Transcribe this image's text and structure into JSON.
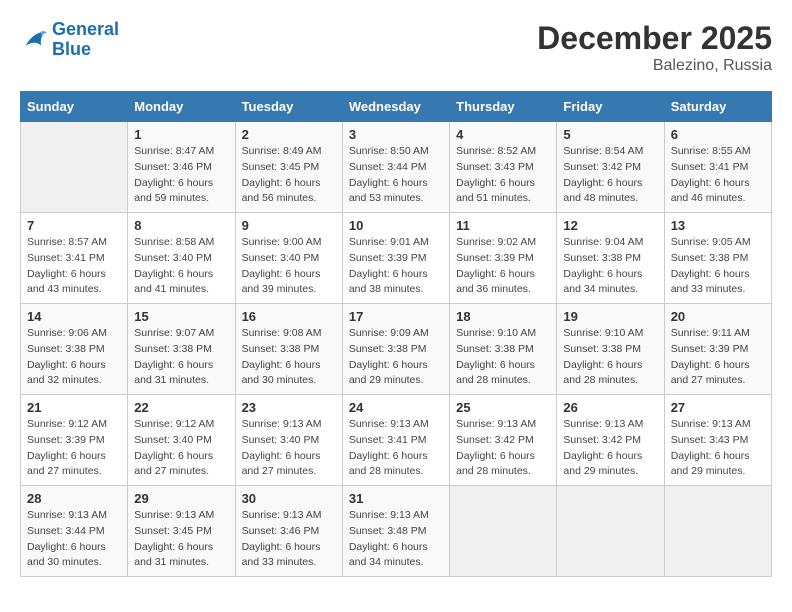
{
  "header": {
    "logo_general": "General",
    "logo_blue": "Blue",
    "month": "December 2025",
    "location": "Balezino, Russia"
  },
  "days_of_week": [
    "Sunday",
    "Monday",
    "Tuesday",
    "Wednesday",
    "Thursday",
    "Friday",
    "Saturday"
  ],
  "weeks": [
    [
      {
        "day": "",
        "sunrise": "",
        "sunset": "",
        "daylight": ""
      },
      {
        "day": "1",
        "sunrise": "Sunrise: 8:47 AM",
        "sunset": "Sunset: 3:46 PM",
        "daylight": "Daylight: 6 hours and 59 minutes."
      },
      {
        "day": "2",
        "sunrise": "Sunrise: 8:49 AM",
        "sunset": "Sunset: 3:45 PM",
        "daylight": "Daylight: 6 hours and 56 minutes."
      },
      {
        "day": "3",
        "sunrise": "Sunrise: 8:50 AM",
        "sunset": "Sunset: 3:44 PM",
        "daylight": "Daylight: 6 hours and 53 minutes."
      },
      {
        "day": "4",
        "sunrise": "Sunrise: 8:52 AM",
        "sunset": "Sunset: 3:43 PM",
        "daylight": "Daylight: 6 hours and 51 minutes."
      },
      {
        "day": "5",
        "sunrise": "Sunrise: 8:54 AM",
        "sunset": "Sunset: 3:42 PM",
        "daylight": "Daylight: 6 hours and 48 minutes."
      },
      {
        "day": "6",
        "sunrise": "Sunrise: 8:55 AM",
        "sunset": "Sunset: 3:41 PM",
        "daylight": "Daylight: 6 hours and 46 minutes."
      }
    ],
    [
      {
        "day": "7",
        "sunrise": "Sunrise: 8:57 AM",
        "sunset": "Sunset: 3:41 PM",
        "daylight": "Daylight: 6 hours and 43 minutes."
      },
      {
        "day": "8",
        "sunrise": "Sunrise: 8:58 AM",
        "sunset": "Sunset: 3:40 PM",
        "daylight": "Daylight: 6 hours and 41 minutes."
      },
      {
        "day": "9",
        "sunrise": "Sunrise: 9:00 AM",
        "sunset": "Sunset: 3:40 PM",
        "daylight": "Daylight: 6 hours and 39 minutes."
      },
      {
        "day": "10",
        "sunrise": "Sunrise: 9:01 AM",
        "sunset": "Sunset: 3:39 PM",
        "daylight": "Daylight: 6 hours and 38 minutes."
      },
      {
        "day": "11",
        "sunrise": "Sunrise: 9:02 AM",
        "sunset": "Sunset: 3:39 PM",
        "daylight": "Daylight: 6 hours and 36 minutes."
      },
      {
        "day": "12",
        "sunrise": "Sunrise: 9:04 AM",
        "sunset": "Sunset: 3:38 PM",
        "daylight": "Daylight: 6 hours and 34 minutes."
      },
      {
        "day": "13",
        "sunrise": "Sunrise: 9:05 AM",
        "sunset": "Sunset: 3:38 PM",
        "daylight": "Daylight: 6 hours and 33 minutes."
      }
    ],
    [
      {
        "day": "14",
        "sunrise": "Sunrise: 9:06 AM",
        "sunset": "Sunset: 3:38 PM",
        "daylight": "Daylight: 6 hours and 32 minutes."
      },
      {
        "day": "15",
        "sunrise": "Sunrise: 9:07 AM",
        "sunset": "Sunset: 3:38 PM",
        "daylight": "Daylight: 6 hours and 31 minutes."
      },
      {
        "day": "16",
        "sunrise": "Sunrise: 9:08 AM",
        "sunset": "Sunset: 3:38 PM",
        "daylight": "Daylight: 6 hours and 30 minutes."
      },
      {
        "day": "17",
        "sunrise": "Sunrise: 9:09 AM",
        "sunset": "Sunset: 3:38 PM",
        "daylight": "Daylight: 6 hours and 29 minutes."
      },
      {
        "day": "18",
        "sunrise": "Sunrise: 9:10 AM",
        "sunset": "Sunset: 3:38 PM",
        "daylight": "Daylight: 6 hours and 28 minutes."
      },
      {
        "day": "19",
        "sunrise": "Sunrise: 9:10 AM",
        "sunset": "Sunset: 3:38 PM",
        "daylight": "Daylight: 6 hours and 28 minutes."
      },
      {
        "day": "20",
        "sunrise": "Sunrise: 9:11 AM",
        "sunset": "Sunset: 3:39 PM",
        "daylight": "Daylight: 6 hours and 27 minutes."
      }
    ],
    [
      {
        "day": "21",
        "sunrise": "Sunrise: 9:12 AM",
        "sunset": "Sunset: 3:39 PM",
        "daylight": "Daylight: 6 hours and 27 minutes."
      },
      {
        "day": "22",
        "sunrise": "Sunrise: 9:12 AM",
        "sunset": "Sunset: 3:40 PM",
        "daylight": "Daylight: 6 hours and 27 minutes."
      },
      {
        "day": "23",
        "sunrise": "Sunrise: 9:13 AM",
        "sunset": "Sunset: 3:40 PM",
        "daylight": "Daylight: 6 hours and 27 minutes."
      },
      {
        "day": "24",
        "sunrise": "Sunrise: 9:13 AM",
        "sunset": "Sunset: 3:41 PM",
        "daylight": "Daylight: 6 hours and 28 minutes."
      },
      {
        "day": "25",
        "sunrise": "Sunrise: 9:13 AM",
        "sunset": "Sunset: 3:42 PM",
        "daylight": "Daylight: 6 hours and 28 minutes."
      },
      {
        "day": "26",
        "sunrise": "Sunrise: 9:13 AM",
        "sunset": "Sunset: 3:42 PM",
        "daylight": "Daylight: 6 hours and 29 minutes."
      },
      {
        "day": "27",
        "sunrise": "Sunrise: 9:13 AM",
        "sunset": "Sunset: 3:43 PM",
        "daylight": "Daylight: 6 hours and 29 minutes."
      }
    ],
    [
      {
        "day": "28",
        "sunrise": "Sunrise: 9:13 AM",
        "sunset": "Sunset: 3:44 PM",
        "daylight": "Daylight: 6 hours and 30 minutes."
      },
      {
        "day": "29",
        "sunrise": "Sunrise: 9:13 AM",
        "sunset": "Sunset: 3:45 PM",
        "daylight": "Daylight: 6 hours and 31 minutes."
      },
      {
        "day": "30",
        "sunrise": "Sunrise: 9:13 AM",
        "sunset": "Sunset: 3:46 PM",
        "daylight": "Daylight: 6 hours and 33 minutes."
      },
      {
        "day": "31",
        "sunrise": "Sunrise: 9:13 AM",
        "sunset": "Sunset: 3:48 PM",
        "daylight": "Daylight: 6 hours and 34 minutes."
      },
      {
        "day": "",
        "sunrise": "",
        "sunset": "",
        "daylight": ""
      },
      {
        "day": "",
        "sunrise": "",
        "sunset": "",
        "daylight": ""
      },
      {
        "day": "",
        "sunrise": "",
        "sunset": "",
        "daylight": ""
      }
    ]
  ]
}
